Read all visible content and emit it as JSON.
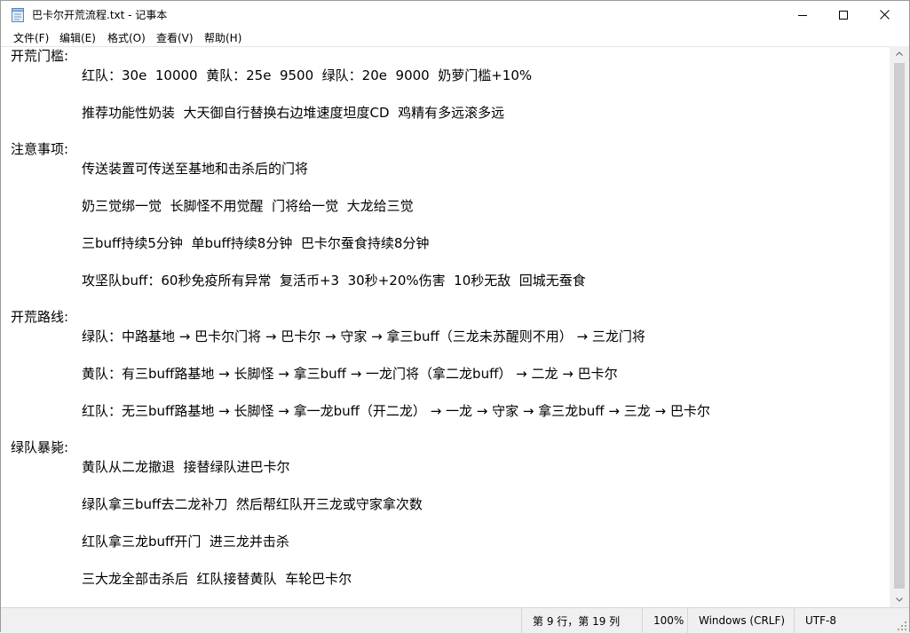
{
  "window": {
    "title": "巴卡尔开荒流程.txt - 记事本",
    "icon": "notepad-icon"
  },
  "menu": [
    {
      "label": "文件(F)"
    },
    {
      "label": "编辑(E)"
    },
    {
      "label": "格式(O)"
    },
    {
      "label": "查看(V)"
    },
    {
      "label": "帮助(H)"
    }
  ],
  "document": {
    "lines": [
      {
        "kind": "head",
        "text": "开荒门槛:"
      },
      {
        "kind": "body",
        "text": "红队：30e  10000  黄队：25e  9500  绿队：20e  9000  奶萝门槛+10%"
      },
      {
        "kind": "body",
        "text": "推荐功能性奶装  大天御自行替换右边堆速度坦度CD  鸡精有多远滚多远"
      },
      {
        "kind": "head",
        "text": "注意事项:"
      },
      {
        "kind": "body",
        "text": "传送装置可传送至基地和击杀后的门将"
      },
      {
        "kind": "body",
        "text": "奶三觉绑一觉  长脚怪不用觉醒  门将给一觉  大龙给三觉"
      },
      {
        "kind": "body",
        "text": "三buff持续5分钟  单buff持续8分钟  巴卡尔蚕食持续8分钟"
      },
      {
        "kind": "body",
        "text": "攻坚队buff：60秒免疫所有异常  复活币+3  30秒+20%伤害  10秒无敌  回城无蚕食"
      },
      {
        "kind": "head",
        "text": "开荒路线:"
      },
      {
        "kind": "body",
        "text": "绿队：中路基地 → 巴卡尔门将 → 巴卡尔 → 守家 → 拿三buff（三龙未苏醒则不用） → 三龙门将"
      },
      {
        "kind": "body",
        "text": "黄队：有三buff路基地 → 长脚怪 → 拿三buff → 一龙门将（拿二龙buff） → 二龙 → 巴卡尔"
      },
      {
        "kind": "body",
        "text": "红队：无三buff路基地 → 长脚怪 → 拿一龙buff（开二龙） → 一龙 → 守家 → 拿三龙buff → 三龙 → 巴卡尔"
      },
      {
        "kind": "head",
        "text": "绿队暴毙:"
      },
      {
        "kind": "body",
        "text": "黄队从二龙撤退  接替绿队进巴卡尔"
      },
      {
        "kind": "body",
        "text": "绿队拿三buff去二龙补刀  然后帮红队开三龙或守家拿次数"
      },
      {
        "kind": "body",
        "text": "红队拿三龙buff开门  进三龙并击杀"
      },
      {
        "kind": "body",
        "text": "三大龙全部击杀后  红队接替黄队  车轮巴卡尔"
      }
    ]
  },
  "status": {
    "position": "第 9 行，第 19 列",
    "zoom": "100%",
    "line_ending": "Windows (CRLF)",
    "encoding": "UTF-8"
  }
}
